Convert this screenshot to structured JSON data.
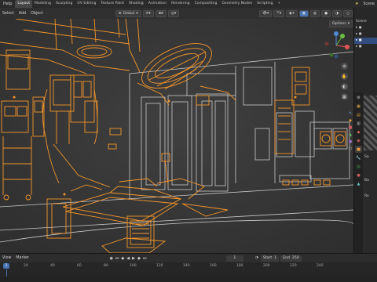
{
  "topbar": {
    "menus": [
      "Help"
    ],
    "workspaces": [
      {
        "label": "Layout",
        "active": true
      },
      {
        "label": "Modeling",
        "active": false
      },
      {
        "label": "Sculpting",
        "active": false
      },
      {
        "label": "UV Editing",
        "active": false
      },
      {
        "label": "Texture Paint",
        "active": false
      },
      {
        "label": "Shading",
        "active": false
      },
      {
        "label": "Animation",
        "active": false
      },
      {
        "label": "Rendering",
        "active": false
      },
      {
        "label": "Compositing",
        "active": false
      },
      {
        "label": "Geometry Nodes",
        "active": false
      },
      {
        "label": "Scripting",
        "active": false
      }
    ],
    "scene_label": "Scene"
  },
  "viewport_header": {
    "menus": [
      "Select",
      "Add",
      "Object"
    ],
    "orientation": "Global",
    "options_label": "Options"
  },
  "outliner": {
    "rows": [
      {
        "label": "Scene",
        "selected": false
      },
      {
        "label": "",
        "selected": false
      },
      {
        "label": "",
        "selected": false
      },
      {
        "label": "",
        "selected": true
      },
      {
        "label": "",
        "selected": false
      }
    ]
  },
  "properties": {
    "labels": [
      "Ba",
      "Ro",
      "Sa"
    ]
  },
  "timeline": {
    "menus": [
      "View",
      "Marker"
    ],
    "current_frame": "1",
    "start_label": "Start",
    "start_value": "1",
    "end_label": "End",
    "end_value": "250",
    "ticks": [
      "20",
      "40",
      "60",
      "80",
      "100",
      "120",
      "140",
      "160",
      "180",
      "200",
      "220",
      "240"
    ]
  },
  "colors": {
    "selection_orange": "#f5962a",
    "accent_blue": "#4772b3",
    "viewport_bg": "#3a3a3a"
  }
}
